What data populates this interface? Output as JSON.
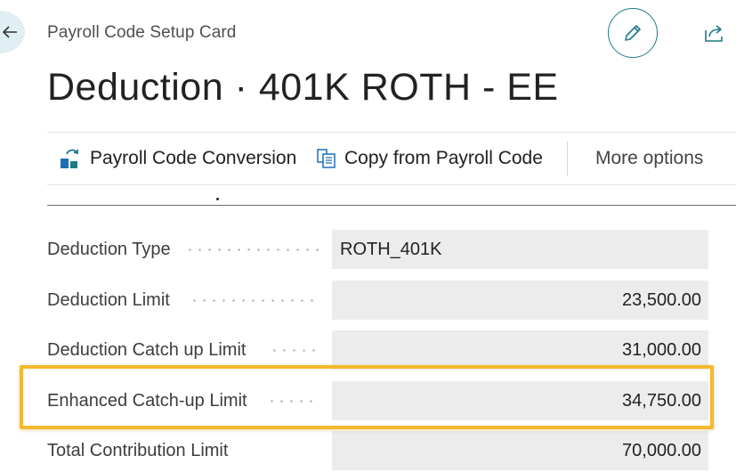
{
  "header": {
    "caption": "Payroll Code Setup Card",
    "title": "Deduction · 401K ROTH - EE"
  },
  "actions": {
    "payroll_code_conversion": "Payroll Code Conversion",
    "copy_from_payroll_code": "Copy from Payroll Code",
    "more_options": "More options"
  },
  "fields": [
    {
      "label": "Deduction Type",
      "value": "ROTH_401K"
    },
    {
      "label": "Deduction Limit",
      "value": "23,500.00"
    },
    {
      "label": "Deduction Catch up Limit",
      "value": "31,000.00"
    },
    {
      "label": "Enhanced Catch-up Limit",
      "value": "34,750.00"
    },
    {
      "label": "Total Contribution Limit",
      "value": "70,000.00"
    }
  ],
  "colors": {
    "accent": "#1d7a86",
    "highlight": "#f5b82e",
    "field_bg": "#ececec",
    "back_button_bg": "#dfeff3"
  },
  "icons": {
    "back": "arrow-left-icon",
    "edit": "pencil-icon",
    "share": "share-icon",
    "conversion": "conversion-icon",
    "copy": "copy-icon"
  }
}
